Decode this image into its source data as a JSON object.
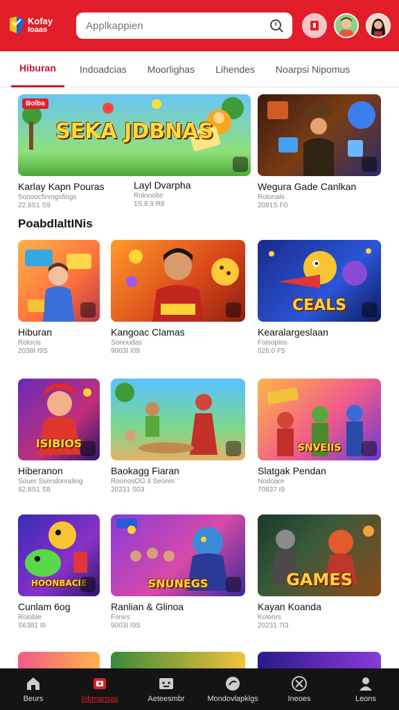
{
  "header": {
    "logo_text_1": "Kofay",
    "logo_text_2": "Ioaas",
    "search_placeholder": "Applkappien"
  },
  "tabs": [
    {
      "label": "Hiburan",
      "active": true
    },
    {
      "label": "Indoadcias",
      "active": false
    },
    {
      "label": "Moorlighas",
      "active": false
    },
    {
      "label": "Lihendes",
      "active": false
    },
    {
      "label": "Noarpsi Nipomus",
      "active": false
    }
  ],
  "featured": [
    {
      "title": "Karlay Kapn Pouras",
      "sub": "Sonoocfinmgsfings",
      "meta": "22.8S1 S9",
      "art": "SEKA JDBNAS",
      "tag": "Bolba"
    },
    {
      "title": "Layl Dvarpha",
      "sub": "Rolnoolte",
      "meta": "1S.8.9 R8",
      "art": "",
      "tag": ""
    },
    {
      "title": "Wegura Gade Canlkan",
      "sub": "Rolonals",
      "meta": "2081S F0",
      "art": "",
      "tag": ""
    }
  ],
  "section_title": "PoabdlaltINis",
  "grid": [
    {
      "title": "Hiburan",
      "sub": "Rolocis",
      "meta": "2038I I9S",
      "art": ""
    },
    {
      "title": "Kangoac Clamas",
      "sub": "Sonoudas",
      "meta": "9003I I09",
      "art": ""
    },
    {
      "title": "Kearalargeslaan",
      "sub": "Folsopins",
      "meta": "026.0 F5",
      "art": "CEALS"
    },
    {
      "title": "Hiberanon",
      "sub": "Souer Ssendonnding",
      "meta": "92.8S1 S8",
      "art": "ISIBIOS"
    },
    {
      "title": "Baokagg Fiaran",
      "sub": "RoonosOG Il Seonm",
      "meta": "20231 S03",
      "art": ""
    },
    {
      "title": "Slatgak Pendan",
      "sub": "Nodoare",
      "meta": "70837 I9",
      "art": "SNVEIIS"
    },
    {
      "title": "Cunlam 6og",
      "sub": "Roloble",
      "meta": "S6381 I9",
      "art": "HOONBACIE"
    },
    {
      "title": "Ranlian & Glinoa",
      "sub": "Fonirs",
      "meta": "9003I I9S",
      "art": "SNUNEGS"
    },
    {
      "title": "Kayan Koanda",
      "sub": "Kolonrs",
      "meta": "20231 7I3",
      "art": "GAMES"
    }
  ],
  "bottom_nav": [
    {
      "label": "Beurs",
      "icon": "home-icon",
      "active": false
    },
    {
      "label": "Inbmansas",
      "icon": "games-icon",
      "active": true
    },
    {
      "label": "Aeteesmbr",
      "icon": "tv-icon",
      "active": false
    },
    {
      "label": "Mondovlapklgs",
      "icon": "compass-icon",
      "active": false
    },
    {
      "label": "Ineoes",
      "icon": "crossed-tools-icon",
      "active": false
    },
    {
      "label": "Leons",
      "icon": "profile-icon",
      "active": false
    }
  ],
  "colors": {
    "brand_red": "#e11d2a",
    "nav_bg": "#141414"
  }
}
